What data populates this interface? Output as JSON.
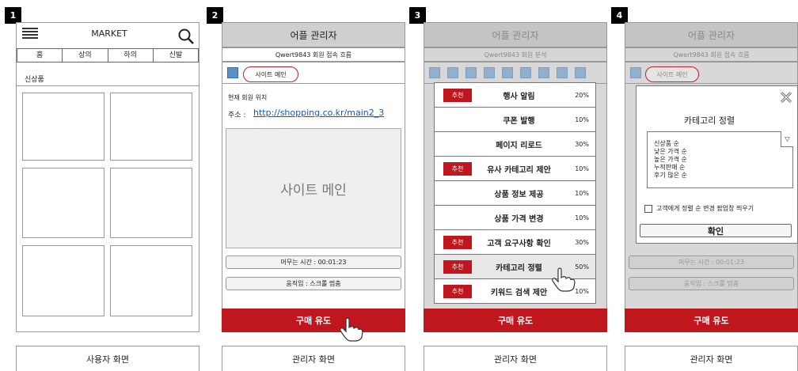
{
  "panels": {
    "p1": {
      "number": "1",
      "title": "MARKET",
      "tabs": [
        "홈",
        "상의",
        "하의",
        "신발"
      ],
      "section": "신상품",
      "caption": "사용자 화면"
    },
    "p2": {
      "number": "2",
      "header": "어플 관리자",
      "subheader": "Qwert9843 회원 접속 흐름",
      "bubble": "사이트 메인",
      "location_label": "현재 회원 위치",
      "address_label": "주소 :",
      "address_url": "http://shopping.co.kr/main2_3",
      "preview": "사이트 메인",
      "stay_time": "머무는 시간 : 00:01:23",
      "motion": "움직임 : 스크롤 멈춤",
      "cta": "구매 유도",
      "caption": "관리자 화면"
    },
    "p3": {
      "number": "3",
      "header": "어플 관리자",
      "subheader": "Qwert9843 회원 분석",
      "badge": "추천",
      "items": [
        {
          "badge": "추천",
          "label": "행사 알림",
          "pct": "20%"
        },
        {
          "badge": "",
          "label": "쿠폰 발행",
          "pct": "10%"
        },
        {
          "badge": "",
          "label": "페이지 리로드",
          "pct": "30%"
        },
        {
          "badge": "추천",
          "label": "유사 카테고리 제안",
          "pct": "10%"
        },
        {
          "badge": "",
          "label": "상품 정보 제공",
          "pct": "10%"
        },
        {
          "badge": "",
          "label": "상품 가격 변경",
          "pct": "10%"
        },
        {
          "badge": "추천",
          "label": "고객 요구사항 확인",
          "pct": "30%"
        },
        {
          "badge": "추천",
          "label": "카테고리 정렬",
          "pct": "50%"
        },
        {
          "badge": "추천",
          "label": "키워드 검색 제안",
          "pct": "10%"
        }
      ],
      "cta": "구매 유도",
      "caption": "관리자 화면"
    },
    "p4": {
      "number": "4",
      "header": "어플 관리자",
      "subheader": "Qwert9843 회원 접속 흐름",
      "bubble": "사이트 메인",
      "stay_time": "머무는 시간 : 00:01:23",
      "motion": "움직임 : 스크롤 멈춤",
      "modal_title": "카테고리 정렬",
      "options": [
        "신상품 순",
        "낮은 가격 순",
        "높은 가격 순",
        "누적판매 순",
        "후기 많은 순"
      ],
      "checkbox_label": "고객에게 정렬 순 변경 팝업창 띄우기",
      "confirm": "확인",
      "cta": "구매 유도",
      "caption": "관리자 화면"
    }
  },
  "colors": {
    "accent_red": "#c0161e",
    "header_gray": "#cfcfcf",
    "blue_square": "#5b8fc7"
  },
  "icons": {
    "menu": "hamburger-icon",
    "search": "search-icon",
    "pointer": "hand-pointer-icon",
    "close": "close-icon",
    "dropdown": "dropdown-arrow-icon"
  }
}
